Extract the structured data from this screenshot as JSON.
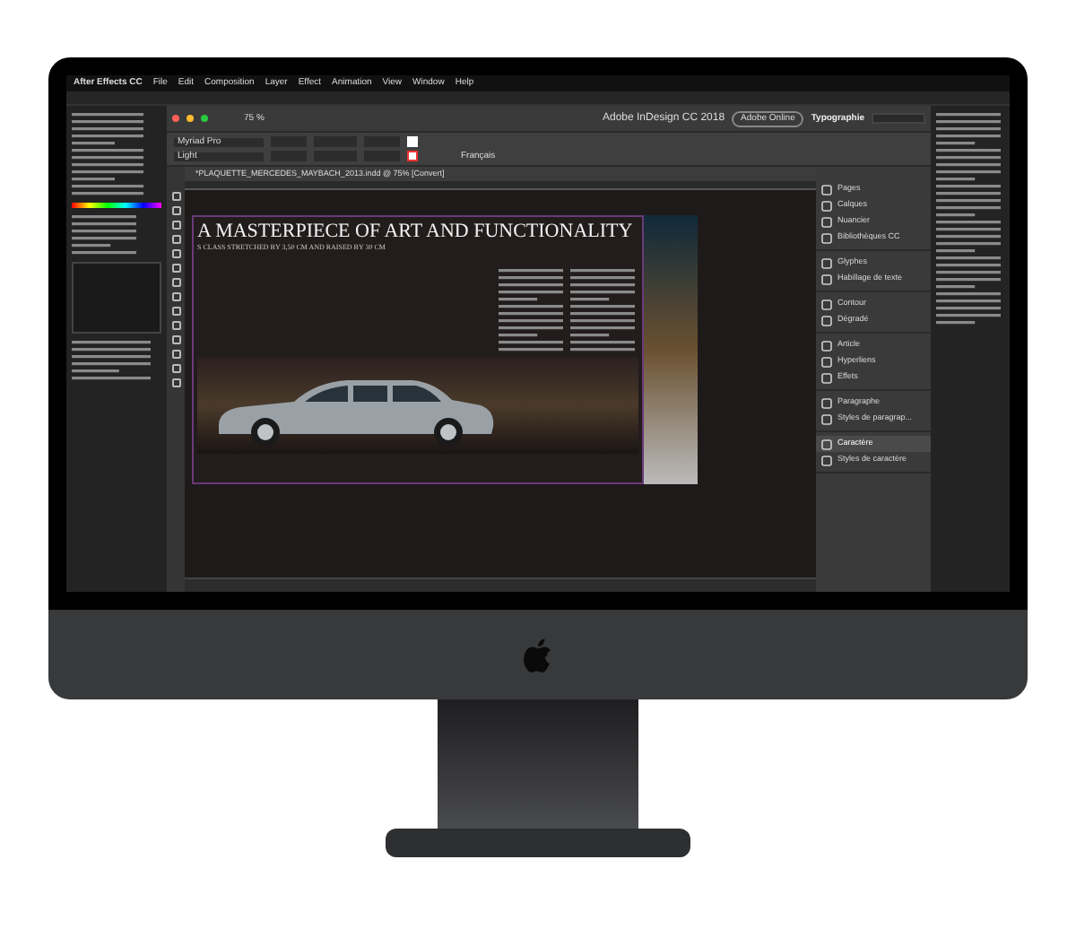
{
  "menu_bar": {
    "app": "After Effects CC",
    "items": [
      "File",
      "Edit",
      "Composition",
      "Layer",
      "Effect",
      "Animation",
      "View",
      "Window",
      "Help"
    ]
  },
  "indesign": {
    "title": "Adobe InDesign CC 2018",
    "zoom": "75 %",
    "online_button": "Adobe Online",
    "workspace": "Typographie",
    "font": "Myriad Pro",
    "font_style": "Light",
    "language": "Français",
    "document_tab": "*PLAQUETTE_MERCEDES_MAYBACH_2013.indd @ 75% [Convert]",
    "page": {
      "heading": "A MASTERPIECE OF ART AND FUNCTIONALITY",
      "subheading": "S CLASS STRETCHED BY 3,50 CM AND RAISED BY 30 CM"
    }
  },
  "panel": {
    "groups": [
      {
        "items": [
          {
            "label": "Pages",
            "selected": false
          },
          {
            "label": "Calques",
            "selected": false
          },
          {
            "label": "Nuancier",
            "selected": false
          },
          {
            "label": "Bibliothèques CC",
            "selected": false
          }
        ]
      },
      {
        "items": [
          {
            "label": "Glyphes",
            "selected": false
          },
          {
            "label": "Habillage de texte",
            "selected": false
          }
        ]
      },
      {
        "items": [
          {
            "label": "Contour",
            "selected": false
          },
          {
            "label": "Dégradé",
            "selected": false
          }
        ]
      },
      {
        "items": [
          {
            "label": "Article",
            "selected": false
          },
          {
            "label": "Hyperliens",
            "selected": false
          },
          {
            "label": "Effets",
            "selected": false
          }
        ]
      },
      {
        "items": [
          {
            "label": "Paragraphe",
            "selected": false
          },
          {
            "label": "Styles de paragrap...",
            "selected": false
          }
        ]
      },
      {
        "items": [
          {
            "label": "Caractère",
            "selected": true
          },
          {
            "label": "Styles de caractère",
            "selected": false
          }
        ]
      }
    ]
  }
}
